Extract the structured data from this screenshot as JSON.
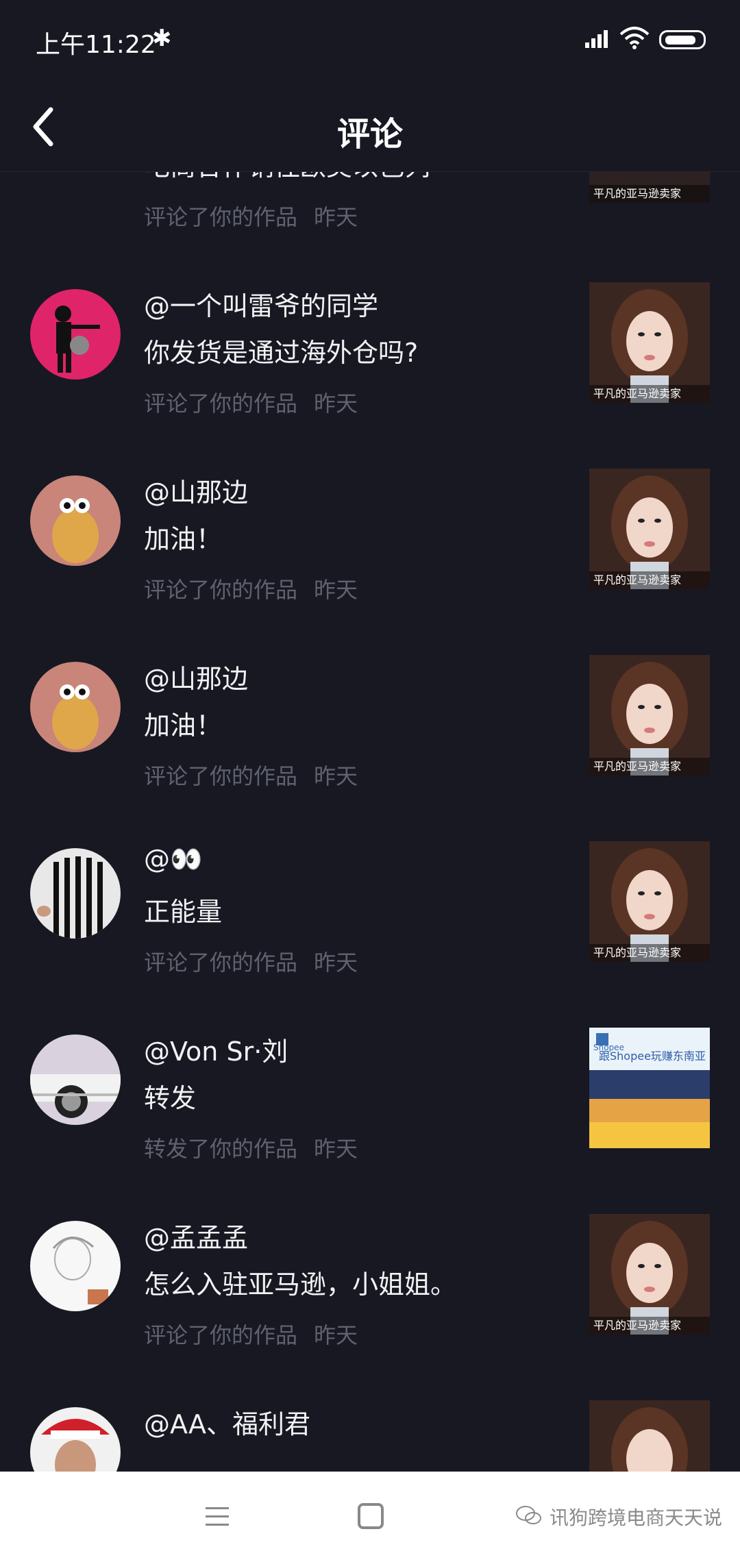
{
  "status_bar": {
    "time": "上午11:22",
    "bluetooth_icon": "bluetooth-icon",
    "signal_icon": "signal-icon",
    "wifi_icon": "wifi-icon",
    "battery_icon": "battery-icon"
  },
  "header": {
    "title": "评论",
    "back_icon": "chevron-left-icon"
  },
  "partial_top": {
    "message": "电商合作销往欧美以色列",
    "action": "评论了你的作品",
    "time": "昨天",
    "thumb_caption": "平凡的亚马逊卖家"
  },
  "notifications": [
    {
      "username": "@一个叫雷爷的同学",
      "message": "你发货是通过海外仓吗?",
      "action": "评论了你的作品",
      "time": "昨天",
      "thumb_caption": "平凡的亚马逊卖家"
    },
    {
      "username": "@山那边",
      "message": "加油！",
      "action": "评论了你的作品",
      "time": "昨天",
      "thumb_caption": "平凡的亚马逊卖家"
    },
    {
      "username": "@山那边",
      "message": "加油！",
      "action": "评论了你的作品",
      "time": "昨天",
      "thumb_caption": "平凡的亚马逊卖家"
    },
    {
      "username": "@👀",
      "message": "正能量",
      "action": "评论了你的作品",
      "time": "昨天",
      "thumb_caption": "平凡的亚马逊卖家"
    },
    {
      "username": "@Von Sr·刘",
      "message": "转发",
      "action": "转发了你的作品",
      "time": "昨天",
      "thumb_caption": "跟Shopee玩赚东南亚",
      "thumb_logo": "Shopee"
    },
    {
      "username": "@孟孟孟",
      "message": "怎么入驻亚马逊，小姐姐。",
      "action": "评论了你的作品",
      "time": "昨天",
      "thumb_caption": "平凡的亚马逊卖家"
    },
    {
      "username": "@AA、福利君",
      "message": "",
      "action": "",
      "time": "",
      "thumb_caption": ""
    }
  ],
  "bottom_nav": {
    "menu_icon": "menu-icon",
    "home_icon": "home-square-icon",
    "back_icon": "back-icon",
    "watermark": "讯狗跨境电商天天说"
  },
  "colors": {
    "background": "#171822",
    "text": "#f2f2f4",
    "meta_text": "#5f6170",
    "bottom_bar": "#ffffff"
  }
}
